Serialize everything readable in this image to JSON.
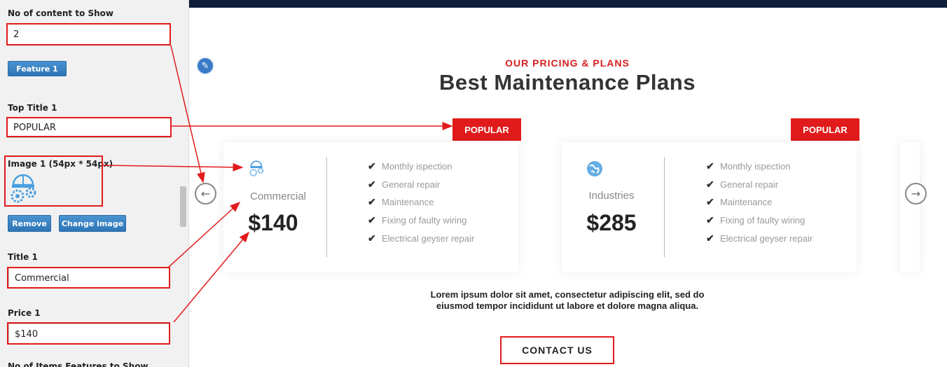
{
  "sidebar": {
    "count_label": "No of content to Show",
    "count_value": "2",
    "feature_button": "Feature 1",
    "top_title_label": "Top Title 1",
    "top_title_value": "POPULAR",
    "image_label": "Image 1 (54px * 54px)",
    "remove_button": "Remove",
    "change_image_button": "Change image",
    "title_label": "Title 1",
    "title_value": "Commercial",
    "price_label": "Price 1",
    "price_value": "$140",
    "next_label": "No of Items Features to Show"
  },
  "main": {
    "eyebrow": "OUR PRICING & PLANS",
    "headline": "Best Maintenance Plans",
    "plans": [
      {
        "badge": "POPULAR",
        "title": "Commercial",
        "price": "$140",
        "icon": "helmet-gears-icon",
        "features": [
          "Monthly ispection",
          "General repair",
          "Maintenance",
          "Fixing of faulty wiring",
          "Electrical geyser repair"
        ]
      },
      {
        "badge": "POPULAR",
        "title": "Industries",
        "price": "$285",
        "icon": "globe-icon",
        "features": [
          "Monthly ispection",
          "General repair",
          "Maintenance",
          "Fixing of faulty wiring",
          "Electrical geyser repair"
        ]
      }
    ],
    "description_line1": "Lorem ipsum dolor sit amet, consectetur adipiscing elit, sed do",
    "description_line2": "eiusmod tempor incididunt ut labore et dolore magna aliqua.",
    "cta": "CONTACT US"
  },
  "colors": {
    "accent_red": "#e11b1b",
    "nav_dark": "#0f1e3a",
    "button_blue": "#2e75b6",
    "icon_blue": "#4a9fe0"
  }
}
